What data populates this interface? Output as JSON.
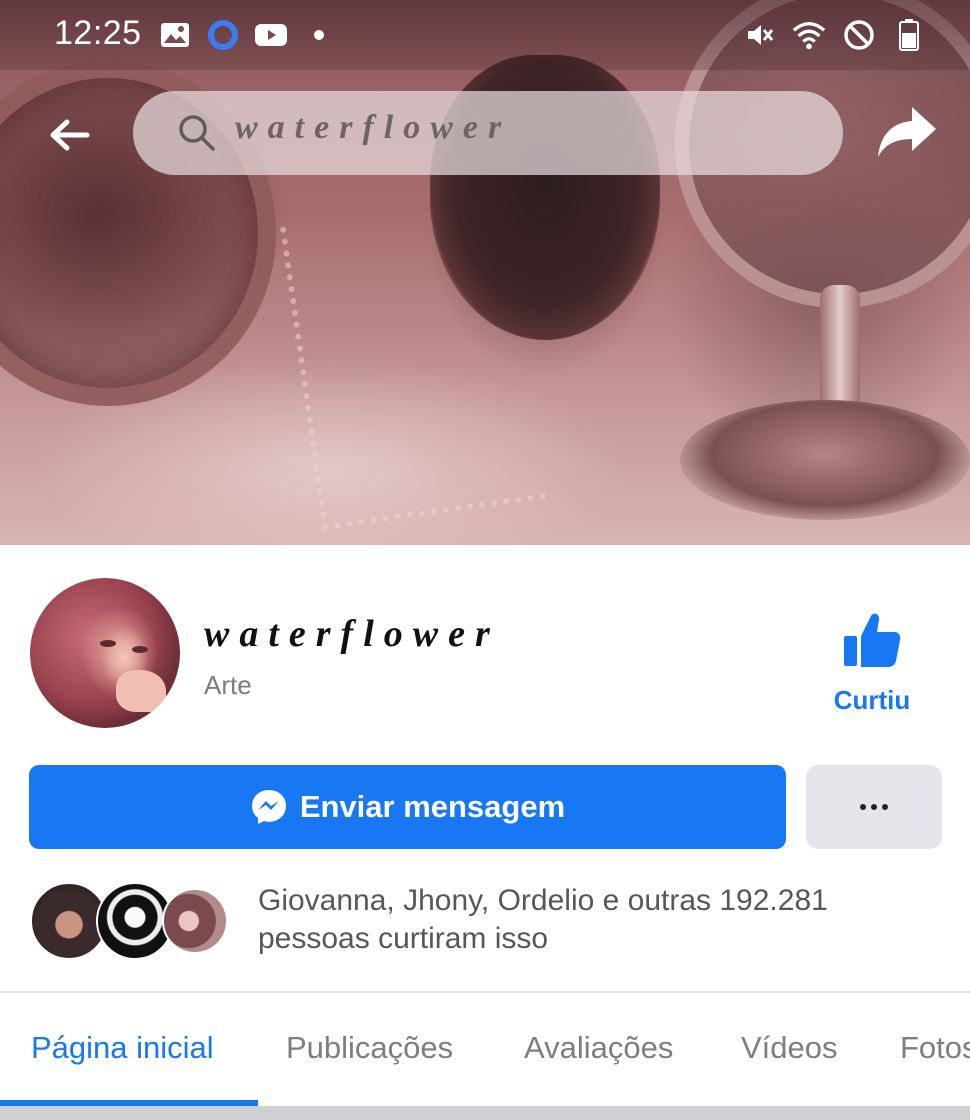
{
  "status_bar": {
    "time": "12:25",
    "left_icons": [
      "gallery-icon",
      "circle-app-icon",
      "youtube-icon",
      "notification-dot-icon"
    ],
    "right_icons": [
      "mute-icon",
      "wifi-icon",
      "do-not-disturb-icon",
      "battery-icon"
    ]
  },
  "header": {
    "search_text": "waterflower",
    "back_icon": "back-arrow-icon",
    "share_icon": "share-icon"
  },
  "profile": {
    "name": "waterflower",
    "category": "Arte",
    "liked_label": "Curtiu"
  },
  "actions": {
    "send_message_label": "Enviar mensagem",
    "more_icon": "more-dots-icon"
  },
  "social": {
    "likes_text": "Giovanna, Jhony, Ordelio e outras 192.281 pessoas curtiram isso"
  },
  "tabs": [
    {
      "label": "Página inicial",
      "active": true
    },
    {
      "label": "Publicações",
      "active": false
    },
    {
      "label": "Avaliações",
      "active": false
    },
    {
      "label": "Vídeos",
      "active": false
    },
    {
      "label": "Fotos",
      "active": false
    }
  ],
  "colors": {
    "accent": "#1877f2",
    "button_secondary": "#e4e6eb",
    "muted_text": "#7b7e83"
  }
}
